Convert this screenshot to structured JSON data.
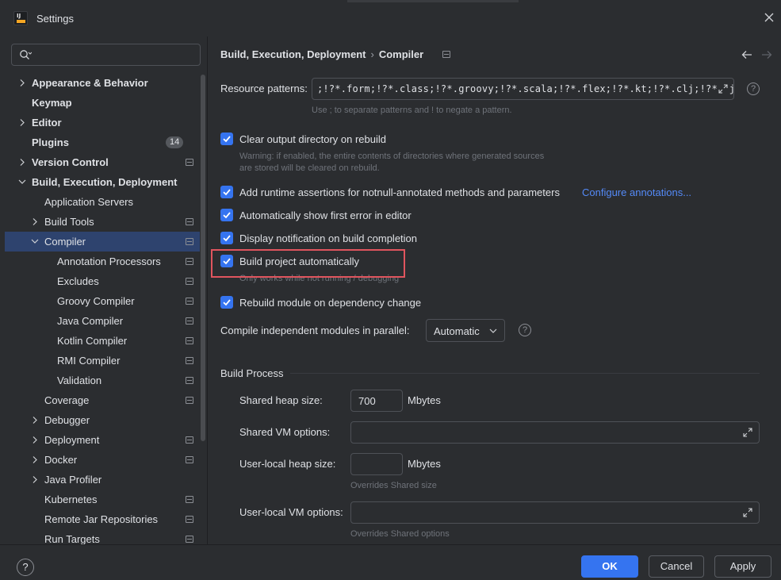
{
  "window": {
    "title": "Settings",
    "app_icon_text": "IJ"
  },
  "search": {
    "placeholder": ""
  },
  "sidebar": {
    "items": [
      {
        "label": "Appearance & Behavior",
        "bold": true,
        "chevron": "right"
      },
      {
        "label": "Keymap",
        "bold": true
      },
      {
        "label": "Editor",
        "bold": true,
        "chevron": "right"
      },
      {
        "label": "Plugins",
        "bold": true,
        "badge": "14"
      },
      {
        "label": "Version Control",
        "bold": true,
        "chevron": "right",
        "project_icon": true
      },
      {
        "label": "Build, Execution, Deployment",
        "bold": true,
        "chevron": "down"
      },
      {
        "label": "Application Servers"
      },
      {
        "label": "Build Tools",
        "chevron": "right",
        "project_icon": true
      },
      {
        "label": "Compiler",
        "chevron": "down",
        "project_icon": true,
        "selected": true
      },
      {
        "label": "Annotation Processors",
        "project_icon": true
      },
      {
        "label": "Excludes",
        "project_icon": true
      },
      {
        "label": "Groovy Compiler",
        "project_icon": true
      },
      {
        "label": "Java Compiler",
        "project_icon": true
      },
      {
        "label": "Kotlin Compiler",
        "project_icon": true
      },
      {
        "label": "RMI Compiler",
        "project_icon": true
      },
      {
        "label": "Validation",
        "project_icon": true
      },
      {
        "label": "Coverage",
        "project_icon": true
      },
      {
        "label": "Debugger",
        "chevron": "right"
      },
      {
        "label": "Deployment",
        "chevron": "right",
        "project_icon": true
      },
      {
        "label": "Docker",
        "chevron": "right",
        "project_icon": true
      },
      {
        "label": "Java Profiler",
        "chevron": "right"
      },
      {
        "label": "Kubernetes",
        "project_icon": true
      },
      {
        "label": "Remote Jar Repositories",
        "project_icon": true
      },
      {
        "label": "Run Targets",
        "project_icon": true
      }
    ]
  },
  "breadcrumb": {
    "parent": "Build, Execution, Deployment",
    "separator": "›",
    "current": "Compiler"
  },
  "resource_patterns": {
    "label": "Resource patterns:",
    "value": ";!?*.form;!?*.class;!?*.groovy;!?*.scala;!?*.flex;!?*.kt;!?*.clj;!?*.aj",
    "hint": "Use ; to separate patterns and ! to negate a pattern."
  },
  "options": {
    "clear_output": {
      "label": "Clear output directory on rebuild",
      "checked": true,
      "warning_line1": "Warning: if enabled, the entire contents of directories where generated sources",
      "warning_line2": "are stored will be cleared on rebuild."
    },
    "runtime_assertions": {
      "label": "Add runtime assertions for notnull-annotated methods and parameters",
      "checked": true,
      "link": "Configure annotations..."
    },
    "show_first_error": {
      "label": "Automatically show first error in editor",
      "checked": true
    },
    "display_notification": {
      "label": "Display notification on build completion",
      "checked": true
    },
    "build_automatically": {
      "label": "Build project automatically",
      "checked": true,
      "hint": "Only works while not running / debugging"
    },
    "rebuild_module": {
      "label": "Rebuild module on dependency change",
      "checked": true
    }
  },
  "parallel": {
    "label": "Compile independent modules in parallel:",
    "value": "Automatic"
  },
  "build_process": {
    "title": "Build Process",
    "shared_heap_label": "Shared heap size:",
    "shared_heap_value": "700",
    "shared_heap_unit": "Mbytes",
    "shared_vm_label": "Shared VM options:",
    "shared_vm_value": "",
    "user_heap_label": "User-local heap size:",
    "user_heap_value": "",
    "user_heap_unit": "Mbytes",
    "user_heap_hint": "Overrides Shared size",
    "user_vm_label": "User-local VM options:",
    "user_vm_value": "",
    "user_vm_hint": "Overrides Shared options"
  },
  "footer": {
    "help": "?",
    "ok": "OK",
    "cancel": "Cancel",
    "apply": "Apply"
  },
  "colors": {
    "accent": "#3574f0",
    "selection": "#2e436e",
    "link": "#548af7",
    "highlight_box": "#e0555e",
    "background": "#2b2d30"
  }
}
